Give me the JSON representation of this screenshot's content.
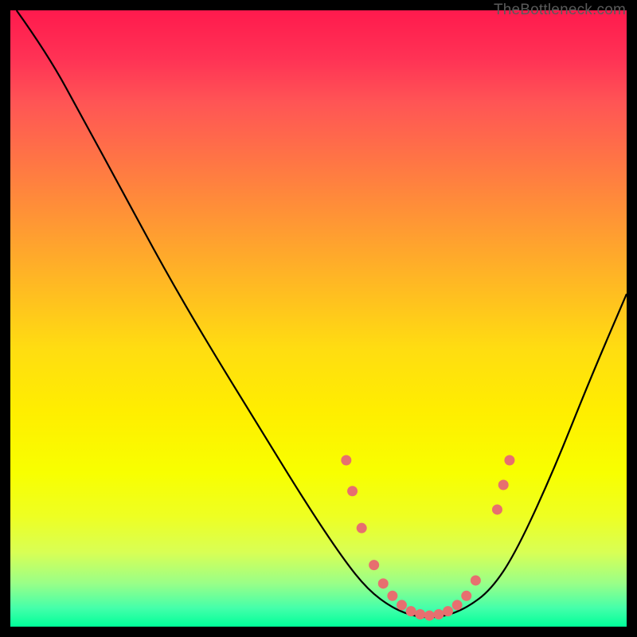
{
  "watermark": "TheBottleneck.com",
  "chart_data": {
    "type": "line",
    "title": "",
    "xlabel": "",
    "ylabel": "",
    "xlim": [
      0,
      100
    ],
    "ylim": [
      0,
      100
    ],
    "curve": [
      {
        "x": 1,
        "y": 100
      },
      {
        "x": 6,
        "y": 93
      },
      {
        "x": 12,
        "y": 82
      },
      {
        "x": 18,
        "y": 71
      },
      {
        "x": 25,
        "y": 58
      },
      {
        "x": 32,
        "y": 46
      },
      {
        "x": 40,
        "y": 33
      },
      {
        "x": 48,
        "y": 20
      },
      {
        "x": 54,
        "y": 11
      },
      {
        "x": 58,
        "y": 6
      },
      {
        "x": 62,
        "y": 3
      },
      {
        "x": 66,
        "y": 1.5
      },
      {
        "x": 70,
        "y": 1.5
      },
      {
        "x": 74,
        "y": 3
      },
      {
        "x": 78,
        "y": 6
      },
      {
        "x": 82,
        "y": 12
      },
      {
        "x": 88,
        "y": 25
      },
      {
        "x": 94,
        "y": 40
      },
      {
        "x": 100,
        "y": 54
      }
    ],
    "markers": [
      {
        "x": 54.5,
        "y": 27
      },
      {
        "x": 55.5,
        "y": 22
      },
      {
        "x": 57,
        "y": 16
      },
      {
        "x": 59,
        "y": 10
      },
      {
        "x": 60.5,
        "y": 7
      },
      {
        "x": 62,
        "y": 5
      },
      {
        "x": 63.5,
        "y": 3.5
      },
      {
        "x": 65,
        "y": 2.5
      },
      {
        "x": 66.5,
        "y": 2
      },
      {
        "x": 68,
        "y": 1.8
      },
      {
        "x": 69.5,
        "y": 2
      },
      {
        "x": 71,
        "y": 2.5
      },
      {
        "x": 72.5,
        "y": 3.5
      },
      {
        "x": 74,
        "y": 5
      },
      {
        "x": 75.5,
        "y": 7.5
      },
      {
        "x": 79,
        "y": 19
      },
      {
        "x": 80,
        "y": 23
      },
      {
        "x": 81,
        "y": 27
      }
    ],
    "marker_color": "#e76f6f",
    "curve_color": "#000000"
  }
}
